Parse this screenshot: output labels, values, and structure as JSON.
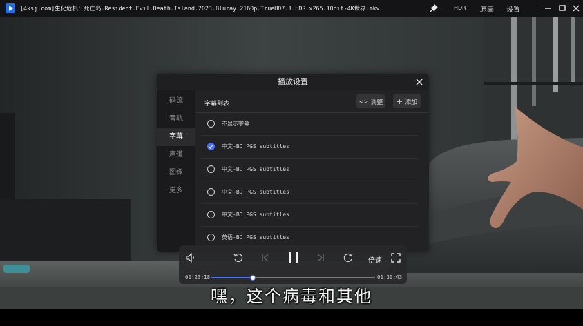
{
  "app": {
    "window_title": "[4ksj.com]生化危机：死亡岛.Resident.Evil.Death.Island.2023.Bluray.2160p.TrueHD7.1.HDR.x265.10bit-4K世界.mkv",
    "titlebar_buttons": {
      "hdr": "HDR",
      "original": "原画",
      "settings": "设置"
    },
    "accent_color": "#4a72ff"
  },
  "panel": {
    "title": "播放设置",
    "nav": [
      {
        "label": "码流"
      },
      {
        "label": "音轨"
      },
      {
        "label": "字幕"
      },
      {
        "label": "声道"
      },
      {
        "label": "图像"
      },
      {
        "label": "更多"
      }
    ],
    "active_nav": "字幕",
    "list_title": "字幕列表",
    "adjust_label": "调整",
    "add_label": "添加",
    "subtitles": [
      {
        "label": "不显示字幕",
        "selected": false
      },
      {
        "label": "中文-BD PGS subtitles",
        "selected": true
      },
      {
        "label": "中文-BD PGS subtitles",
        "selected": false
      },
      {
        "label": "中文-BD PGS subtitles",
        "selected": false
      },
      {
        "label": "中文-BD PGS subtitles",
        "selected": false
      },
      {
        "label": "英语-BD PGS subtitles",
        "selected": false
      }
    ]
  },
  "player": {
    "speed_label": "倍速",
    "current_time": "00:23:18",
    "total_time": "01:30:43",
    "progress": 0.257
  },
  "caption": "嘿，这个病毒和其他"
}
